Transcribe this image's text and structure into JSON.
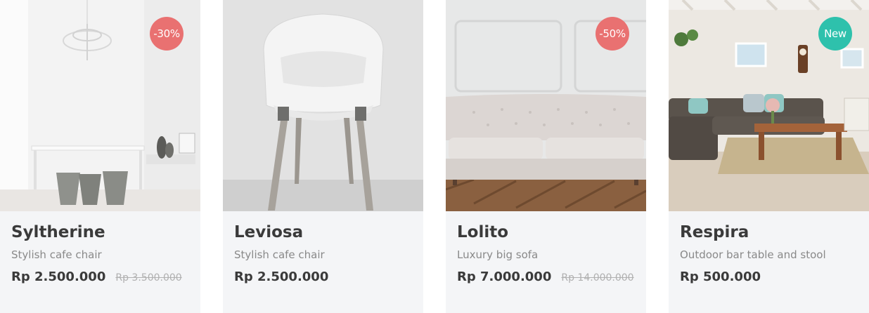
{
  "products": [
    {
      "name": "Syltherine",
      "description": "Stylish cafe chair",
      "price": "Rp 2.500.000",
      "old_price": "Rp 3.500.000",
      "badge": "-30%",
      "badge_type": "sale"
    },
    {
      "name": "Leviosa",
      "description": "Stylish cafe chair",
      "price": "Rp 2.500.000",
      "old_price": "",
      "badge": "",
      "badge_type": ""
    },
    {
      "name": "Lolito",
      "description": "Luxury big sofa",
      "price": "Rp 7.000.000",
      "old_price": "Rp 14.000.000",
      "badge": "-50%",
      "badge_type": "sale"
    },
    {
      "name": "Respira",
      "description": "Outdoor bar table and stool",
      "price": "Rp 500.000",
      "old_price": "",
      "badge": "New",
      "badge_type": "new"
    }
  ],
  "colors": {
    "card_background": "#f4f5f7",
    "sale_badge": "#e97171",
    "new_badge": "#2ec1ac",
    "title_text": "#3a3a3a",
    "description_text": "#898989",
    "old_price_text": "#b0b0b0"
  }
}
